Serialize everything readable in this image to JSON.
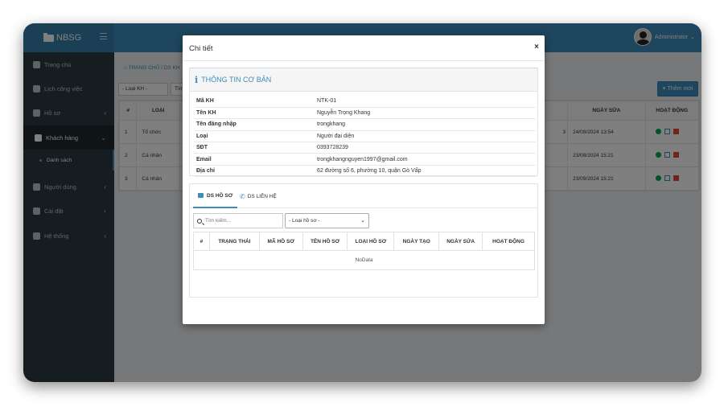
{
  "app": {
    "brand": "NBSG",
    "user": "Administrator"
  },
  "sidebar": {
    "items": [
      {
        "label": "Trang chủ",
        "icon": "home-icon"
      },
      {
        "label": "Lịch công việc",
        "icon": "calendar-icon"
      },
      {
        "label": "Hồ sơ",
        "icon": "folder-icon"
      },
      {
        "label": "Khách hàng",
        "icon": "user-icon"
      },
      {
        "label": "Người dùng",
        "icon": "users-icon"
      },
      {
        "label": "Cài đặt",
        "icon": "user-gear-icon"
      },
      {
        "label": "Hệ thống",
        "icon": "gear-icon"
      }
    ],
    "sub_item": "Danh sách"
  },
  "breadcrumb": {
    "home": "TRANG CHỦ",
    "current": "/ DS KH"
  },
  "filters": {
    "type": "- Loại KH -",
    "other": "Tìm"
  },
  "add_button": "Thêm mới",
  "main_table": {
    "headers": [
      "#",
      "LOẠI",
      "NGÀY SỬA",
      "HOẠT ĐỘNG"
    ],
    "rows": [
      {
        "num": "1",
        "type": "Tổ chức",
        "partial": "3",
        "modified": "24/09/2024 13:54"
      },
      {
        "num": "2",
        "type": "Cá nhân",
        "partial": "",
        "modified": "23/09/2024 15:21"
      },
      {
        "num": "3",
        "type": "Cá nhân",
        "partial": "",
        "modified": "23/09/2024 15:21"
      }
    ]
  },
  "modal": {
    "title": "Chi tiết",
    "close": "×",
    "section_title": "THÔNG TIN CƠ BẢN",
    "info": [
      {
        "key": "Mã KH",
        "value": "NTK-01"
      },
      {
        "key": "Tên KH",
        "value": "Nguyễn Trọng Khang"
      },
      {
        "key": "Tên đăng nhập",
        "value": "trongkhang"
      },
      {
        "key": "Loại",
        "value": "Người đại diện"
      },
      {
        "key": "SĐT",
        "value": "0393728239"
      },
      {
        "key": "Email",
        "value": "trongkhangnguyen1997@gmail.com"
      },
      {
        "key": "Địa chỉ",
        "value": "62 đường số 6, phường 10, quận Gò Vấp"
      }
    ],
    "tabs": [
      {
        "label": "DS HỒ SƠ",
        "icon": "folder-icon"
      },
      {
        "label": "DS LIÊN HỆ",
        "icon": "phone-icon"
      }
    ],
    "search_placeholder": "Tìm kiếm...",
    "doc_type_select": "- Loại hồ sơ -",
    "doc_table": {
      "headers": [
        "#",
        "TRẠNG THÁI",
        "MÃ HỒ SƠ",
        "TÊN HỒ SƠ",
        "LOẠI HỒ SƠ",
        "NGÀY TẠO",
        "NGÀY SỬA",
        "HOẠT ĐỘNG"
      ],
      "empty": "NoData"
    }
  },
  "colors": {
    "primary": "#3c8dbc",
    "sidebar": "#2c3b41",
    "view": "#00a65a",
    "edit": "#3c8dbc",
    "delete": "#dd4b39"
  }
}
